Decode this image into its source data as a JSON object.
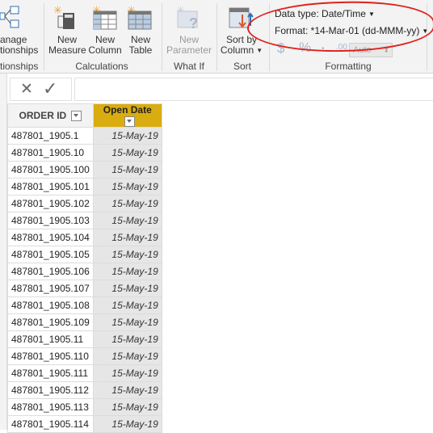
{
  "ribbon": {
    "relationships": {
      "manage_label_line1": "anage",
      "manage_label_line2": "tionships",
      "group_label": "tionships"
    },
    "calculations": {
      "group_label": "Calculations",
      "new_measure": [
        "New",
        "Measure"
      ],
      "new_column": [
        "New",
        "Column"
      ],
      "new_table": [
        "New",
        "Table"
      ]
    },
    "what_if": {
      "group_label": "What If",
      "new_parameter": [
        "New",
        "Parameter"
      ]
    },
    "sort": {
      "group_label": "Sort",
      "sort_by_column": [
        "Sort by",
        "Column"
      ]
    },
    "formatting": {
      "group_label": "Formatting",
      "data_type": "Data type: Date/Time",
      "format": "Format: *14-Mar-01 (dd-MMM-yy)",
      "currency_symbol": "$",
      "percent_symbol": "%",
      "comma_symbol": "•",
      "decimal_symbol": ".00",
      "auto_value": "Auto"
    }
  },
  "formula_bar": {
    "cancel": "✕",
    "commit": "✓",
    "value": ""
  },
  "table": {
    "columns": [
      {
        "header": "ORDER ID"
      },
      {
        "header": "Open Date"
      }
    ],
    "rows": [
      [
        "487801_1905.1",
        "15-May-19"
      ],
      [
        "487801_1905.10",
        "15-May-19"
      ],
      [
        "487801_1905.100",
        "15-May-19"
      ],
      [
        "487801_1905.101",
        "15-May-19"
      ],
      [
        "487801_1905.102",
        "15-May-19"
      ],
      [
        "487801_1905.103",
        "15-May-19"
      ],
      [
        "487801_1905.104",
        "15-May-19"
      ],
      [
        "487801_1905.105",
        "15-May-19"
      ],
      [
        "487801_1905.106",
        "15-May-19"
      ],
      [
        "487801_1905.107",
        "15-May-19"
      ],
      [
        "487801_1905.108",
        "15-May-19"
      ],
      [
        "487801_1905.109",
        "15-May-19"
      ],
      [
        "487801_1905.11",
        "15-May-19"
      ],
      [
        "487801_1905.110",
        "15-May-19"
      ],
      [
        "487801_1905.111",
        "15-May-19"
      ],
      [
        "487801_1905.112",
        "15-May-19"
      ],
      [
        "487801_1905.113",
        "15-May-19"
      ],
      [
        "487801_1905.114",
        "15-May-19"
      ]
    ]
  },
  "colors": {
    "selected_header": "#d9ac0f",
    "annotation": "#e0201b"
  }
}
